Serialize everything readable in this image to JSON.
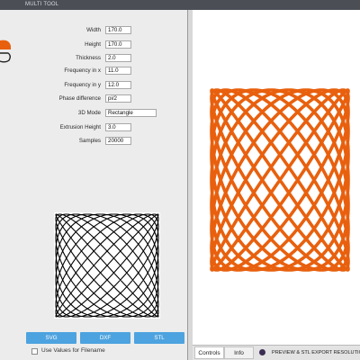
{
  "window": {
    "title": "MULTI TOOL"
  },
  "colors": {
    "accent": "#4da3df",
    "curve3d": "#e8600e",
    "curve2d": "#000000",
    "logo": "#e8600e"
  },
  "form": {
    "fields": [
      {
        "label": "Width",
        "value": "170.0"
      },
      {
        "label": "Height",
        "value": "170.0"
      },
      {
        "label": "Thickness",
        "value": "2.0"
      },
      {
        "label": "Frequency in x",
        "value": "11.0"
      },
      {
        "label": "Frequency in y",
        "value": "12.0"
      },
      {
        "label": "Phase difference",
        "value": "pi/2"
      },
      {
        "label": "3D Mode",
        "value": "Rectangle"
      },
      {
        "label": "Extrusion Height",
        "value": "3.0"
      },
      {
        "label": "Samples",
        "value": "20000"
      }
    ]
  },
  "buttons": {
    "svg": "SVG",
    "dxf": "DXF",
    "stl": "STL"
  },
  "checkbox": {
    "label": "Use Values for Filename"
  },
  "bottom": {
    "tab_controls": "Controls",
    "tab_info": "Info",
    "export_label": "PREVIEW & STL EXPORT RESOLUTION"
  },
  "icons": {
    "logo": "app-logo-icon",
    "status": "status-dot-icon"
  }
}
